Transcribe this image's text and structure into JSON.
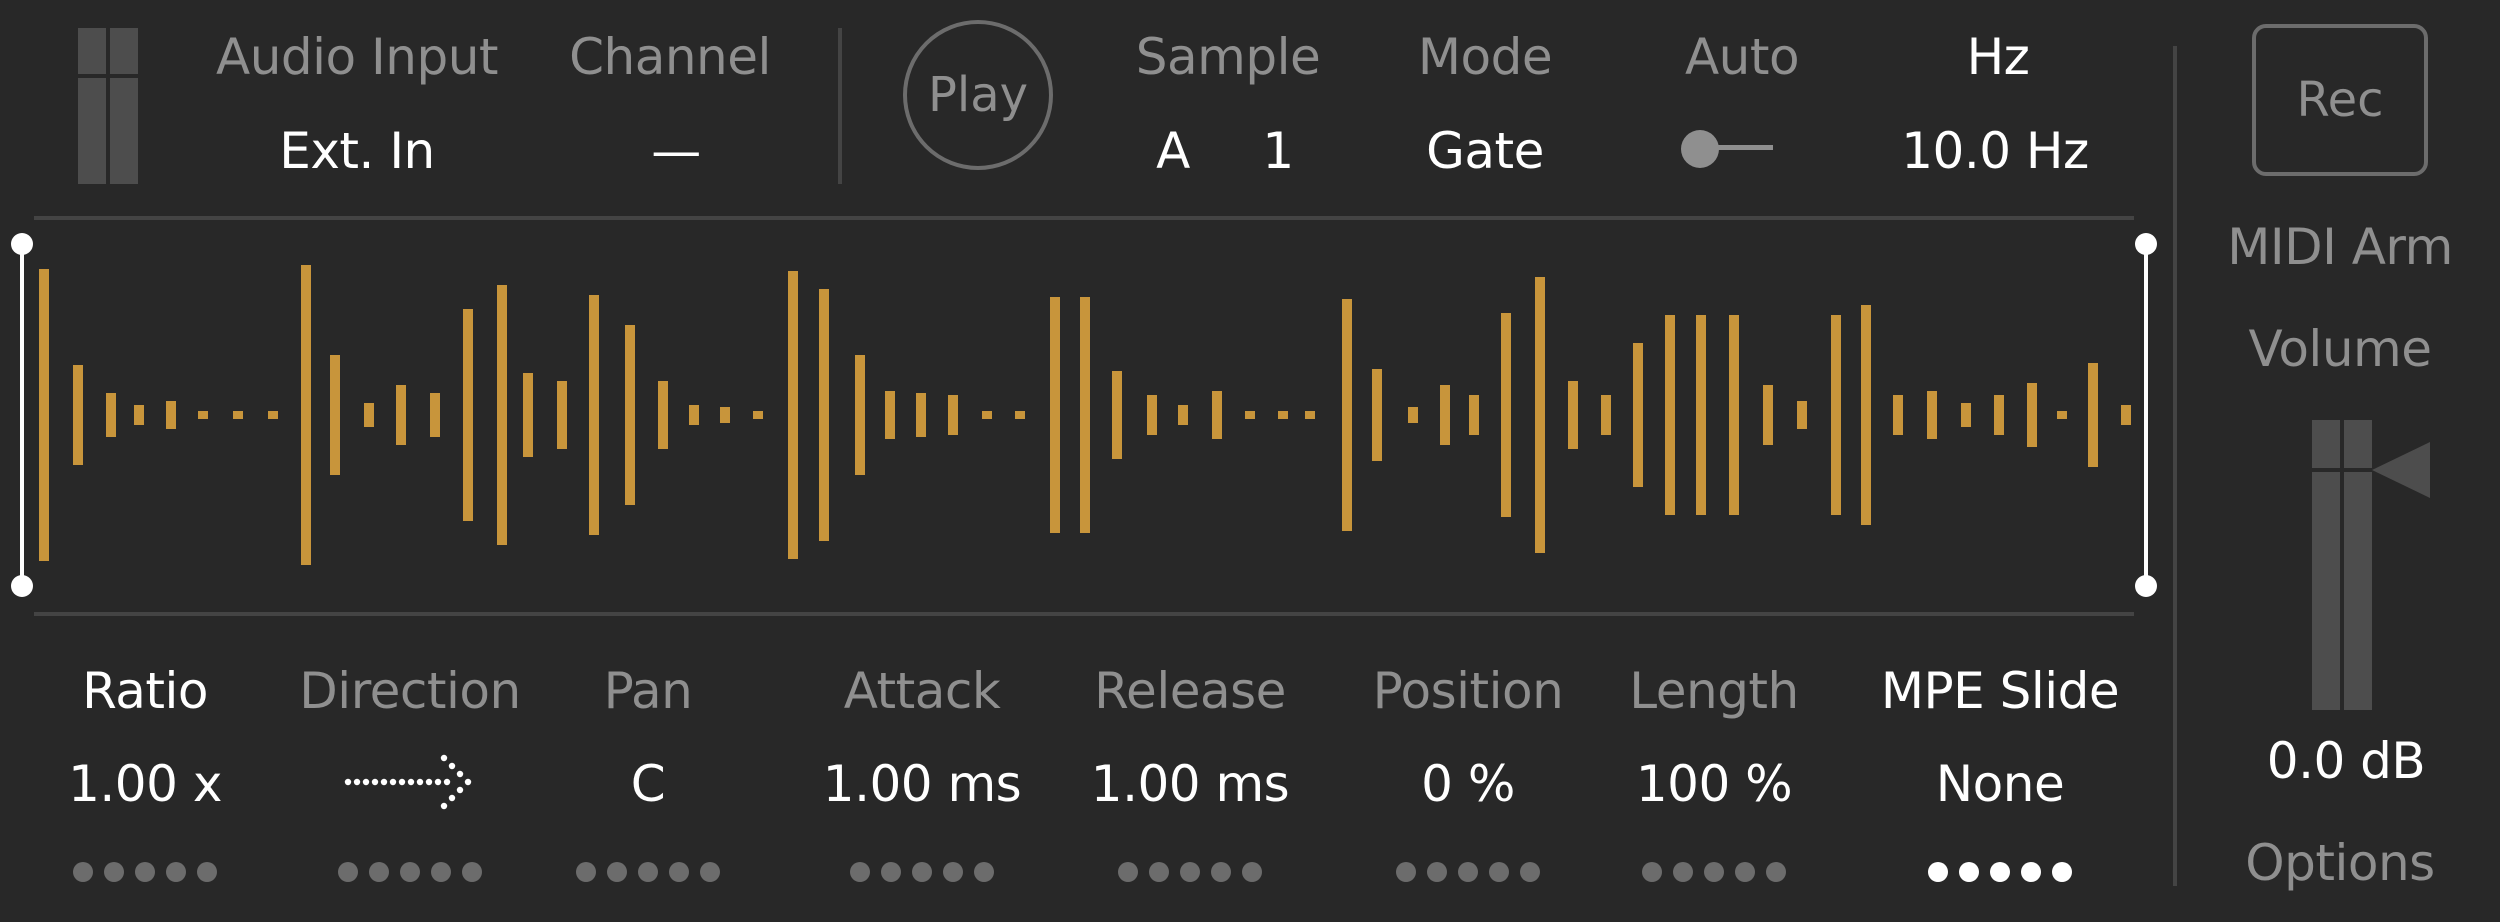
{
  "colors": {
    "background": "#282828",
    "waveform": "#c8953b",
    "label_dim": "#8f8f8f",
    "text_bright": "#ffffff",
    "divider": "#444444"
  },
  "top": {
    "audio_input": {
      "label": "Audio Input",
      "value": "Ext. In"
    },
    "channel": {
      "label": "Channel",
      "value": "—"
    },
    "play_label": "Play",
    "sample": {
      "label": "Sample",
      "letter": "A",
      "number": "1"
    },
    "mode": {
      "label": "Mode",
      "value": "Gate"
    },
    "auto": {
      "label": "Auto",
      "state": "off"
    },
    "hz": {
      "label": "Hz",
      "value": "10.0 Hz"
    }
  },
  "right": {
    "rec_label": "Rec",
    "midi_arm_label": "MIDI Arm",
    "volume_label": "Volume",
    "volume_value": "0.0 dB",
    "options_label": "Options"
  },
  "params": [
    {
      "label": "Ratio",
      "value": "1.00 x",
      "active": true,
      "dots_active": false
    },
    {
      "label": "Direction",
      "value": "",
      "icon": "dotted-arrow-right-icon",
      "active": false,
      "dots_active": false
    },
    {
      "label": "Pan",
      "value": "C",
      "active": false,
      "dots_active": false
    },
    {
      "label": "Attack",
      "value": "1.00 ms",
      "active": false,
      "dots_active": false
    },
    {
      "label": "Release",
      "value": "1.00 ms",
      "active": false,
      "dots_active": false
    },
    {
      "label": "Position",
      "value": "0 %",
      "active": false,
      "dots_active": false
    },
    {
      "label": "Length",
      "value": "100 %",
      "active": false,
      "dots_active": false
    },
    {
      "label": "MPE Slide",
      "value": "None",
      "active": true,
      "dots_active": true
    }
  ]
}
